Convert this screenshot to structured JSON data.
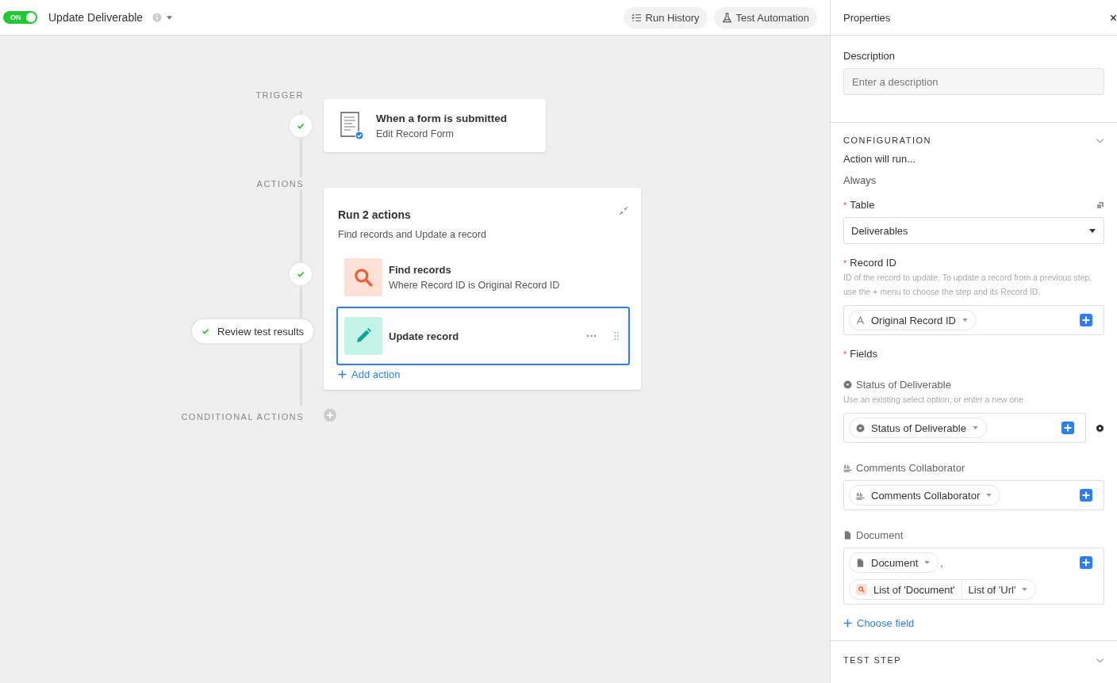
{
  "header": {
    "toggle": {
      "label": "ON",
      "on": true
    },
    "title": "Update Deliverable",
    "buttons": [
      {
        "kind": "history",
        "label": "Run History"
      },
      {
        "kind": "test",
        "label": "Test Automation"
      }
    ]
  },
  "flow": {
    "trigger_label": "TRIGGER",
    "trigger": {
      "title": "When a form is submitted",
      "subtitle": "Edit Record Form",
      "done": true
    },
    "actions_label": "ACTIONS",
    "group": {
      "title": "Run 2 actions",
      "subtitle": "Find records and Update a record",
      "add_label": "Add action",
      "steps": [
        {
          "kind": "find",
          "title": "Find records",
          "subtitle": "Where Record ID is Original Record ID",
          "done": true,
          "selected": false
        },
        {
          "kind": "update",
          "title": "Update record",
          "selected": true
        }
      ]
    },
    "review_label": "Review test results",
    "conditional_label": "CONDITIONAL ACTIONS"
  },
  "properties": {
    "title": "Properties",
    "description": {
      "label": "Description",
      "placeholder": "Enter a description"
    },
    "configuration": {
      "heading": "CONFIGURATION",
      "expanded": true,
      "run_label": "Action will run...",
      "run_value": "Always",
      "table": {
        "label": "Table",
        "required_mark": "*",
        "value": "Deliverables"
      },
      "record_id": {
        "label": "Record ID",
        "required_mark": "*",
        "help": "ID of the record to update. To update a record from a previous step, use the + menu to choose the step and its Record ID.",
        "token": {
          "kind": "text",
          "parts": [
            "Original Record ID"
          ]
        }
      },
      "fields_label": {
        "label": "Fields",
        "required_mark": "*"
      },
      "fields": [
        {
          "kind": "select",
          "label": "Status of Deliverable",
          "help": "Use an existing select option, or enter a new one",
          "settings": true,
          "rows": [
            {
              "tokens": [
                {
                  "kind": "select",
                  "parts": [
                    "Status of Deliverable"
                  ]
                }
              ]
            }
          ]
        },
        {
          "kind": "longtext",
          "label": "Comments Collaborator",
          "rows": [
            {
              "tokens": [
                {
                  "kind": "longtext",
                  "parts": [
                    "Comments Collaborator"
                  ]
                }
              ]
            }
          ]
        },
        {
          "kind": "file",
          "label": "Document",
          "rows": [
            {
              "tokens": [
                {
                  "kind": "file",
                  "parts": [
                    "Document"
                  ]
                }
              ],
              "suffix": ","
            },
            {
              "tokens": [
                {
                  "kind": "find",
                  "parts": [
                    "List of 'Document'",
                    "List of 'Url'"
                  ]
                }
              ]
            }
          ]
        }
      ],
      "choose_label": "Choose field"
    },
    "test_step": {
      "heading": "TEST STEP",
      "expanded": false
    }
  }
}
